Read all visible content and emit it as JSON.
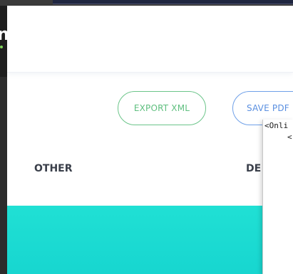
{
  "window": {
    "logo_glyph": "n"
  },
  "toolbar": {
    "export_xml_label": "EXPORT XML",
    "save_pdf_label": "SAVE PDF"
  },
  "sections": {
    "other_label": "OTHER",
    "de_label": "DE"
  },
  "xml_popup": {
    "line1": "<Onli",
    "line2": "<"
  },
  "colors": {
    "export_xml": "#5fbf7f",
    "save_pdf": "#5a8fe0",
    "teal_band": "#1ee0d6"
  }
}
